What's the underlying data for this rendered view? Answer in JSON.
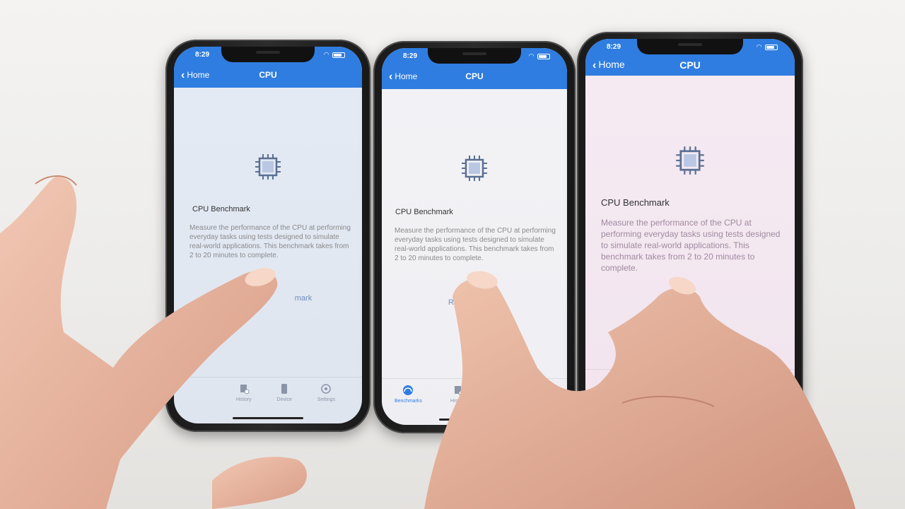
{
  "phones": [
    {
      "status": {
        "time": "8:29"
      },
      "nav": {
        "back_label": "Home",
        "title": "CPU"
      },
      "benchmark": {
        "title": "CPU Benchmark",
        "description": "Measure the performance of the CPU at performing everyday tasks using tests designed to simulate real-world applications. This benchmark takes from 2 to 20 minutes to complete.",
        "run_label": "mark"
      },
      "tabs": [
        {
          "label": "History",
          "icon": "history-icon"
        },
        {
          "label": "Device",
          "icon": "device-icon"
        },
        {
          "label": "Settings",
          "icon": "settings-icon"
        }
      ],
      "screen_tint": "#dfe7f3"
    },
    {
      "status": {
        "time": "8:29"
      },
      "nav": {
        "back_label": "Home",
        "title": "CPU"
      },
      "benchmark": {
        "title": "CPU Benchmark",
        "description": "Measure the performance of the CPU at performing everyday tasks using tests designed to simulate real-world applications. This benchmark takes from 2 to 20 minutes to complete.",
        "run_label": "Ru"
      },
      "tabs": [
        {
          "label": "Benchmarks",
          "icon": "benchmarks-icon"
        },
        {
          "label": "History",
          "icon": "history-icon"
        }
      ],
      "screen_tint": "#f3f3f6"
    },
    {
      "status": {
        "time": "8:29"
      },
      "nav": {
        "back_label": "Home",
        "title": "CPU"
      },
      "benchmark": {
        "title": "CPU Benchmark",
        "description": "Measure the performance of the CPU at performing everyday tasks using tests designed to simulate real-world applications. This benchmark takes from 2 to 20 minutes to complete.",
        "run_label": "R"
      },
      "tabs": [
        {
          "label": "",
          "icon": "benchmarks-icon"
        },
        {
          "label": "",
          "icon": "history-icon"
        }
      ],
      "screen_tint": "#f4e8f1"
    }
  ],
  "colors": {
    "nav_blue": "#2f7de0",
    "skin": "#e9b9a3",
    "description_grey": "#8a8a8a"
  }
}
